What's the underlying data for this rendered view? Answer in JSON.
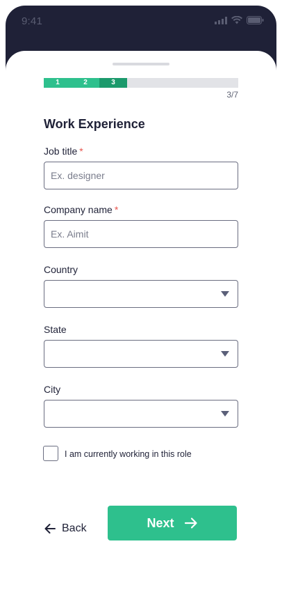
{
  "status_bar": {
    "time": "9:41",
    "icons": [
      "cellular-signal-icon",
      "wifi-icon",
      "battery-icon"
    ]
  },
  "progress": {
    "steps": [
      "1",
      "2",
      "3"
    ],
    "count": "3/7",
    "current_step": 3,
    "total_steps": 7
  },
  "form": {
    "title": "Work Experience",
    "job_title": {
      "label": "Job title",
      "required_mark": "*",
      "placeholder": "Ex. designer"
    },
    "company_name": {
      "label": "Company name",
      "required_mark": "*",
      "placeholder": "Ex. Aimit"
    },
    "country": {
      "label": "Country",
      "value": ""
    },
    "state": {
      "label": "State",
      "value": ""
    },
    "city": {
      "label": "City",
      "value": ""
    },
    "current_role": {
      "label": "I am currently working in this role",
      "checked": false
    }
  },
  "actions": {
    "back_label": "Back",
    "next_label": "Next"
  },
  "colors": {
    "primary": "#2ec08d",
    "primary_dark": "#1c9a6c",
    "header_bg": "#1f2137",
    "required": "#e8554e",
    "text": "#1f2137"
  }
}
